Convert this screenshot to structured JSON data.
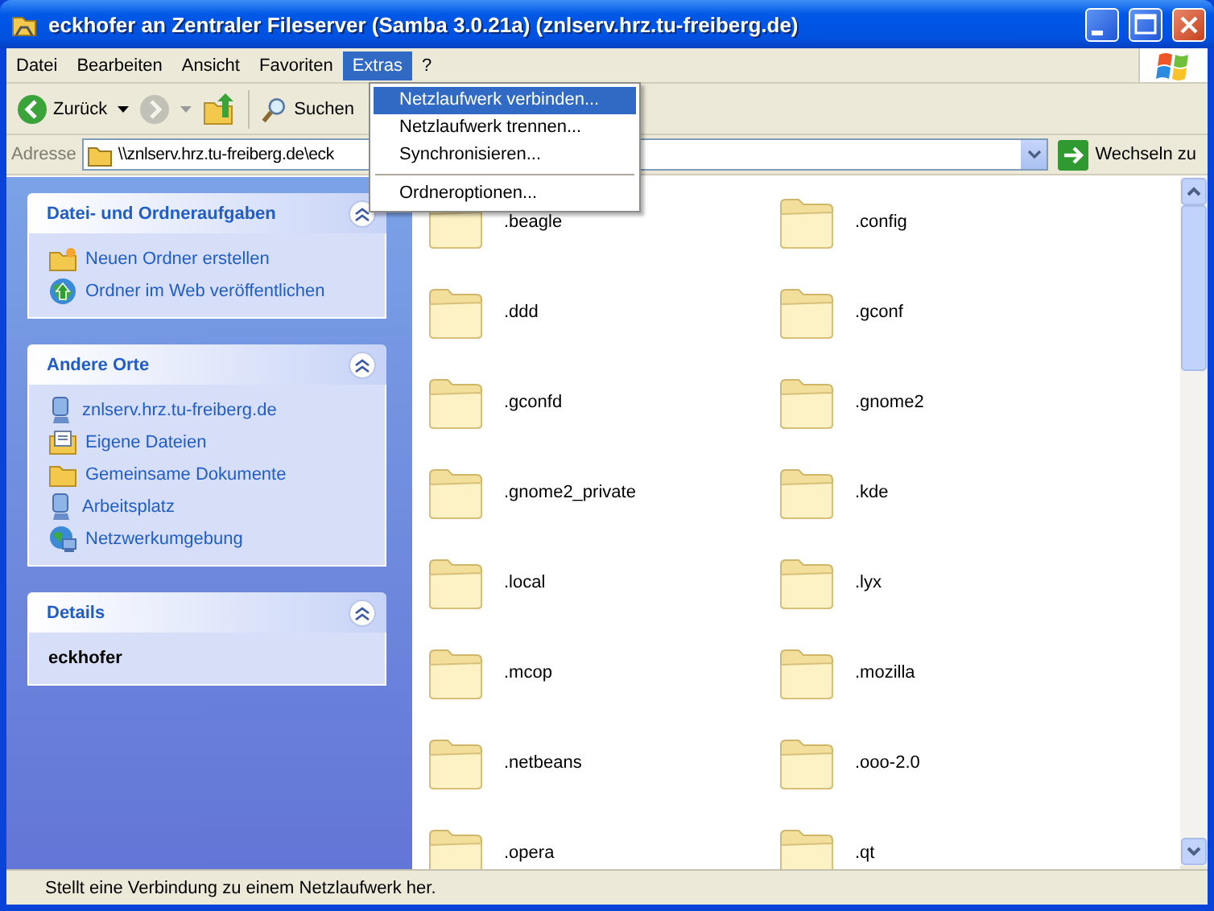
{
  "window": {
    "title": "eckhofer an Zentraler Fileserver (Samba 3.0.21a) (znlserv.hrz.tu-freiberg.de)"
  },
  "menu_bar": [
    {
      "label": "Datei",
      "selected": false
    },
    {
      "label": "Bearbeiten",
      "selected": false
    },
    {
      "label": "Ansicht",
      "selected": false
    },
    {
      "label": "Favoriten",
      "selected": false
    },
    {
      "label": "Extras",
      "selected": true
    },
    {
      "label": "?",
      "selected": false
    }
  ],
  "open_menu": [
    {
      "kind": "item",
      "label": "Netzlaufwerk verbinden...",
      "selected": true
    },
    {
      "kind": "item",
      "label": "Netzlaufwerk trennen...",
      "selected": false
    },
    {
      "kind": "item",
      "label": "Synchronisieren...",
      "selected": false
    },
    {
      "kind": "separator"
    },
    {
      "kind": "item",
      "label": "Ordneroptionen...",
      "selected": false
    }
  ],
  "toolbar": {
    "back": {
      "label": "Zurück",
      "disabled": false
    },
    "forward": {
      "disabled": true
    },
    "search": {
      "label": "Suchen"
    }
  },
  "address": {
    "label": "Adresse",
    "value": "\\\\znlserv.hrz.tu-freiberg.de\\eck",
    "go_label": "Wechseln zu"
  },
  "task_panes": [
    {
      "kind": "links",
      "title": "Datei- und Ordneraufgaben",
      "expanded": true,
      "items": [
        {
          "kind": "new-folder",
          "label": "Neuen Ordner erstellen"
        },
        {
          "kind": "publish",
          "label": "Ordner im Web veröffentlichen"
        }
      ]
    },
    {
      "kind": "links",
      "title": "Andere Orte",
      "expanded": true,
      "items": [
        {
          "kind": "computer",
          "label": "znlserv.hrz.tu-freiberg.de"
        },
        {
          "kind": "documents",
          "label": "Eigene Dateien"
        },
        {
          "kind": "folder",
          "label": "Gemeinsame Dokumente"
        },
        {
          "kind": "computer",
          "label": "Arbeitsplatz"
        },
        {
          "kind": "network",
          "label": "Netzwerkumgebung"
        }
      ]
    },
    {
      "kind": "details",
      "title": "Details",
      "expanded": true,
      "text": "eckhofer"
    }
  ],
  "folders": [
    ".beagle",
    ".config",
    ".ddd",
    ".gconf",
    ".gconfd",
    ".gnome2",
    ".gnome2_private",
    ".kde",
    ".local",
    ".lyx",
    ".mcop",
    ".mozilla",
    ".netbeans",
    ".ooo-2.0",
    ".opera",
    ".qt"
  ],
  "status_bar": {
    "text": "Stellt eine Verbindung zu einem Netzlaufwerk her."
  }
}
